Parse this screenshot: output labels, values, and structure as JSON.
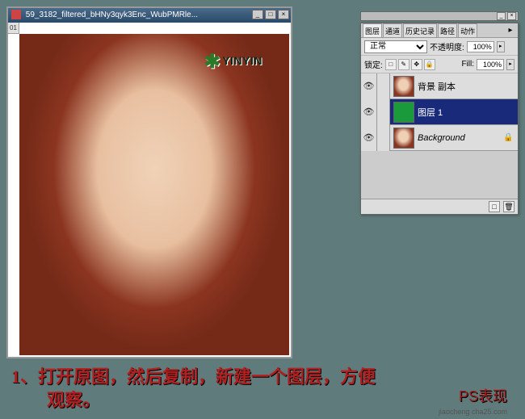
{
  "image_window": {
    "title": "59_3182_filtered_bHNy3qyk3Enc_WubPMRle...",
    "zoom_indicator": "01",
    "watermark": "YINYIN"
  },
  "panel_strip": {
    "min": "_",
    "close": "×"
  },
  "layers_panel": {
    "tabs": [
      "图层",
      "通道",
      "历史记录",
      "路径",
      "动作"
    ],
    "active_tab_index": 0,
    "blend_mode": "正常",
    "opacity_label": "不透明度:",
    "opacity_value": "100%",
    "lock_label": "锁定:",
    "fill_label": "Fill:",
    "fill_value": "100%",
    "lock_icons": [
      "□",
      "✎",
      "✥",
      "🔒"
    ],
    "layers": [
      {
        "name": "背景 副本",
        "thumb": "photo",
        "selected": false,
        "italic": false,
        "locked": false
      },
      {
        "name": "图层 1",
        "thumb": "green",
        "selected": true,
        "italic": false,
        "locked": false
      },
      {
        "name": "Background",
        "thumb": "photo",
        "selected": false,
        "italic": true,
        "locked": true
      }
    ]
  },
  "caption": {
    "text": "1、打开原图，然后复制，新建一个图层，方便\n　　观察。",
    "watermark": "PS表现",
    "small": "jiaocheng cha25.com"
  }
}
